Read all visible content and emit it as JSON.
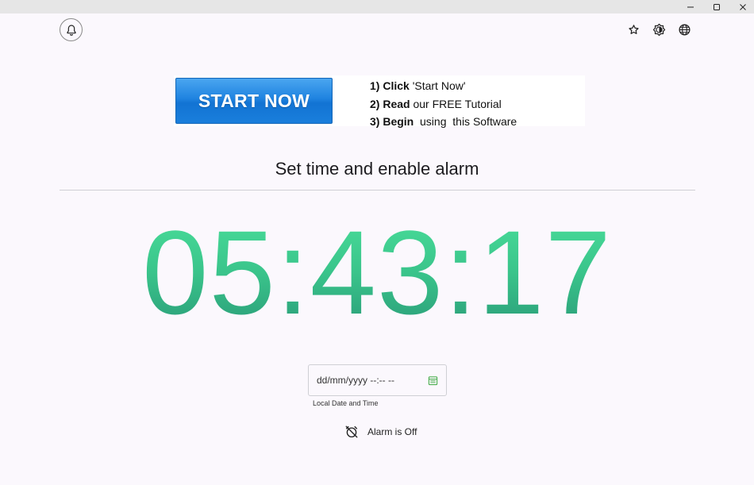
{
  "window": {
    "controls": [
      "minimize",
      "maximize",
      "close"
    ]
  },
  "header": {
    "bell_icon": "bell-icon",
    "right_icons": [
      "star-icon",
      "brightness-icon",
      "globe-icon"
    ]
  },
  "banner": {
    "button_label": "START NOW",
    "steps": [
      {
        "bold": "1) Click",
        "rest": " 'Start Now'"
      },
      {
        "bold": "2) Read",
        "rest": " our FREE Tutorial"
      },
      {
        "bold": "3) Begin",
        "rest": "  using  this Software"
      }
    ]
  },
  "main": {
    "heading": "Set time and enable alarm",
    "clock": "05:43:17",
    "clock_colors": [
      "#49dd99",
      "#2a9c78"
    ],
    "datetime_input": {
      "value": "dd/mm/yyyy --:-- --",
      "label": "Local Date and Time",
      "icon": "calendar-icon",
      "icon_color": "#4caf50"
    },
    "alarm": {
      "icon": "alarm-off-icon",
      "status": "Alarm is Off"
    }
  }
}
